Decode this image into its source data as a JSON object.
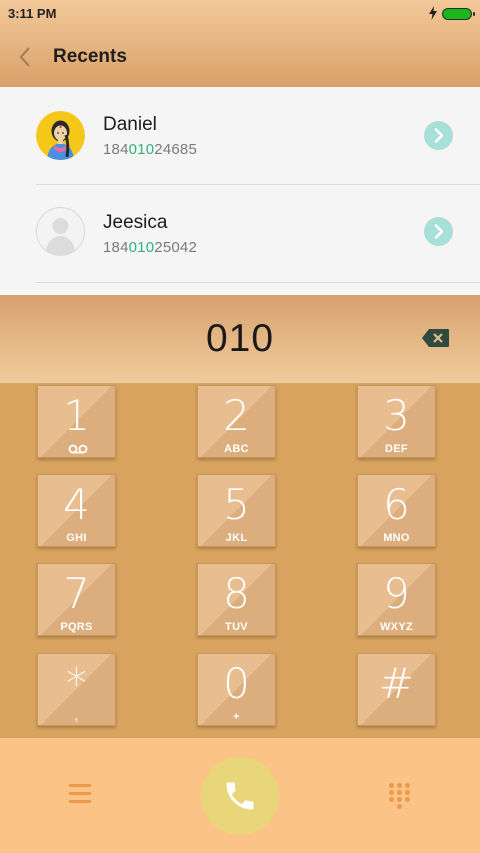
{
  "status_bar": {
    "time": "3:11 PM",
    "battery_color": "#1bb61b"
  },
  "header": {
    "title": "Recents",
    "back_icon": "chevron-left-icon"
  },
  "recents": [
    {
      "name": "Daniel",
      "number_prefix": "184",
      "number_match": "010",
      "number_suffix": "24685",
      "avatar": "illustrated-woman-avatar"
    },
    {
      "name": "Jeesica",
      "number_prefix": "184",
      "number_match": "010",
      "number_suffix": "25042",
      "avatar": "default-person-avatar"
    }
  ],
  "dialer": {
    "input_value": "010",
    "backspace_icon": "backspace-icon"
  },
  "keypad": [
    {
      "digit": "1",
      "letters": ""
    },
    {
      "digit": "2",
      "letters": "ABC"
    },
    {
      "digit": "3",
      "letters": "DEF"
    },
    {
      "digit": "4",
      "letters": "GHI"
    },
    {
      "digit": "5",
      "letters": "JKL"
    },
    {
      "digit": "6",
      "letters": "MNO"
    },
    {
      "digit": "7",
      "letters": "PQRS"
    },
    {
      "digit": "8",
      "letters": "TUV"
    },
    {
      "digit": "9",
      "letters": "WXYZ"
    },
    {
      "digit": "*",
      "letters": ","
    },
    {
      "digit": "0",
      "letters": "+"
    },
    {
      "digit": "#",
      "letters": ""
    }
  ],
  "bottom_bar": {
    "menu_icon": "menu-icon",
    "call_icon": "phone-icon",
    "dialpad_icon": "dialpad-icon",
    "call_color": "#ead67a",
    "accent": "#ec9a4e"
  },
  "colors": {
    "match_highlight": "#2eb47e",
    "chevron_bg": "#a7e0d8"
  }
}
